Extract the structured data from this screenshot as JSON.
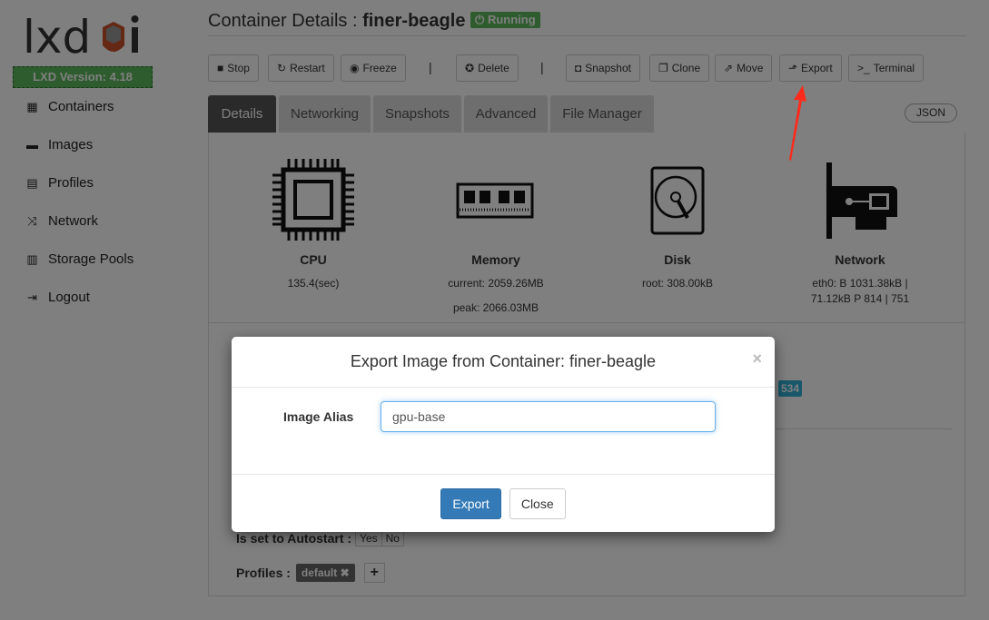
{
  "sidebar": {
    "logo": "lxdui",
    "version": "LXD Version: 4.18",
    "items": [
      {
        "label": "Containers",
        "icon": "th-grid-icon"
      },
      {
        "label": "Images",
        "icon": "hdd-icon"
      },
      {
        "label": "Profiles",
        "icon": "list-icon"
      },
      {
        "label": "Network",
        "icon": "random-icon"
      },
      {
        "label": "Storage Pools",
        "icon": "tasks-icon"
      },
      {
        "label": "Logout",
        "icon": "logout-icon"
      }
    ]
  },
  "header": {
    "title_prefix": "Container Details :",
    "container": "finer-beagle",
    "status": "Running"
  },
  "toolbar": {
    "stop": "Stop",
    "restart": "Restart",
    "freeze": "Freeze",
    "sep": "|",
    "delete": "Delete",
    "snapshot": "Snapshot",
    "clone": "Clone",
    "move": "Move",
    "export": "Export",
    "terminal": "Terminal"
  },
  "tabs": [
    "Details",
    "Networking",
    "Snapshots",
    "Advanced",
    "File Manager"
  ],
  "json_label": "JSON",
  "stats": {
    "cpu": {
      "label": "CPU",
      "value": "135.4(sec)"
    },
    "memory": {
      "label": "Memory",
      "current": "current: 2059.26MB",
      "peak": "peak: 2066.03MB"
    },
    "disk": {
      "label": "Disk",
      "value": "root: 308.00kB"
    },
    "network": {
      "label": "Network",
      "line1": "eth0: B 1031.38kB |",
      "line2": "71.12kB P 814 | 751"
    }
  },
  "details": {
    "badge": "534",
    "autostart_label": "Is set to Autostart :",
    "yes": "Yes",
    "no": "No",
    "profiles_label": "Profiles :",
    "profile": "default",
    "add": "+"
  },
  "modal": {
    "title": "Export Image from Container: finer-beagle",
    "close_x": "×",
    "field_label": "Image Alias",
    "field_value": "gpu-base",
    "export": "Export",
    "close": "Close"
  },
  "colors": {
    "accent": "#337ab7",
    "running": "#5cb85c",
    "annotation_arrow": "#ff2a1a"
  }
}
